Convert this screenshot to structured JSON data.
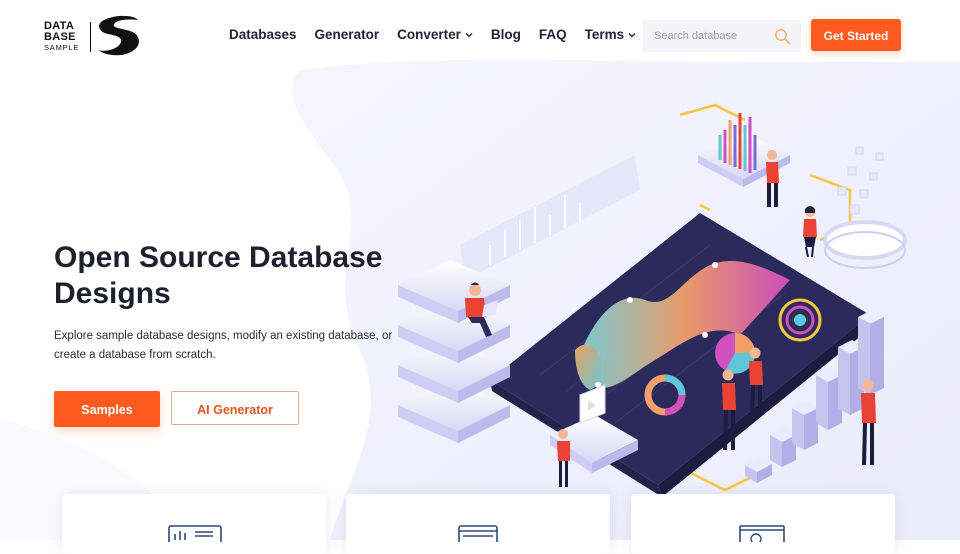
{
  "brand": {
    "logo_line1": "DATA",
    "logo_line2": "BASE",
    "logo_line3": "SAMPLE",
    "accent_color": "#ff5a1f",
    "dark_color": "#1f1f2e"
  },
  "nav": {
    "items": [
      {
        "label": "Databases",
        "has_dropdown": false
      },
      {
        "label": "Generator",
        "has_dropdown": false
      },
      {
        "label": "Converter",
        "has_dropdown": true
      },
      {
        "label": "Blog",
        "has_dropdown": false
      },
      {
        "label": "FAQ",
        "has_dropdown": false
      },
      {
        "label": "Terms",
        "has_dropdown": true
      }
    ]
  },
  "search": {
    "placeholder": "Search database",
    "value": "",
    "icon": "search-icon"
  },
  "header": {
    "cta_label": "Get Started"
  },
  "hero": {
    "title": "Open Source Database Designs",
    "description": "Explore sample database designs, modify an existing database, or create a database from scratch.",
    "primary_button": "Samples",
    "secondary_button": "AI Generator"
  },
  "cards": [
    {
      "icon": "dashboard-icon"
    },
    {
      "icon": "stacked-window-icon"
    },
    {
      "icon": "presentation-board-icon"
    }
  ]
}
